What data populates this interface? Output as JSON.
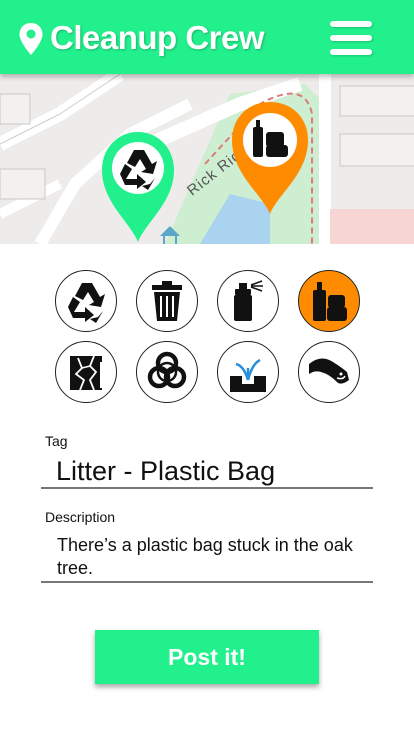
{
  "app": {
    "title": "Cleanup Crew",
    "accent_color": "#22f08d",
    "selected_color": "#ff8c00",
    "header_icon": "location-pin-icon",
    "menu_icon": "hamburger-menu-icon"
  },
  "map": {
    "street_label": "Rick Rid Path",
    "markers": [
      {
        "icon": "recycle-icon",
        "color": "#22f08d"
      },
      {
        "icon": "bottles-icon",
        "color": "#ff8c00"
      }
    ]
  },
  "categories": [
    {
      "icon": "recycle-icon",
      "selected": false
    },
    {
      "icon": "trash-can-icon",
      "selected": false
    },
    {
      "icon": "spray-can-icon",
      "selected": false
    },
    {
      "icon": "bottles-icon",
      "selected": true
    },
    {
      "icon": "broken-glass-icon",
      "selected": false
    },
    {
      "icon": "biohazard-icon",
      "selected": false
    },
    {
      "icon": "water-leak-icon",
      "selected": false
    },
    {
      "icon": "oil-spill-icon",
      "selected": false
    }
  ],
  "form": {
    "tag_label": "Tag",
    "tag_value": "Litter - Plastic Bag",
    "description_label": "Description",
    "description_value": "There’s a plastic bag stuck in the oak tree.",
    "submit_label": "Post it!"
  }
}
